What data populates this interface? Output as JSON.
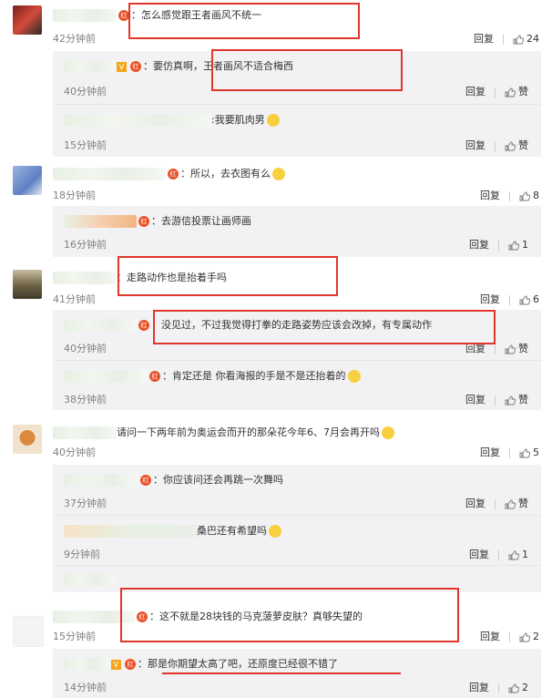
{
  "comments": [
    {
      "text": "：怎么感觉跟王者画风不统一",
      "time": "42分钟前",
      "reply": "回复",
      "likes": "24"
    },
    {
      "text": "：所以，去衣图有么",
      "time": "18分钟前",
      "reply": "回复",
      "likes": "8"
    },
    {
      "text": "：走路动作也是抬着手吗",
      "time": "41分钟前",
      "reply": "回复",
      "likes": "6"
    },
    {
      "text": "请问一下两年前为奥运会而开的那朵花今年6、7月会再开吗",
      "time": "40分钟前",
      "reply": "回复",
      "likes": "5"
    },
    {
      "text": "：这不就是28块钱的马克菠萝皮肤？真够失望的",
      "time": "15分钟前",
      "reply": "回复",
      "likes": "2"
    }
  ],
  "replies": [
    {
      "text": "：要仿真啊，王者画风不适合梅西",
      "time": "40分钟前",
      "reply": "回复",
      "likes": "赞"
    },
    {
      "text": ":我要肌肉男",
      "time": "15分钟前",
      "reply": "回复",
      "likes": "赞"
    },
    {
      "text": "：去游信投票让画师画",
      "time": "16分钟前",
      "reply": "回复",
      "likes": "1"
    },
    {
      "text": "：没见过，不过我觉得打拳的走路姿势应该会改掉，有专属动作",
      "time": "40分钟前",
      "reply": "回复",
      "likes": "赞"
    },
    {
      "text": "：肯定还是  你看海报的手是不是还抬着的",
      "time": "38分钟前",
      "reply": "回复",
      "likes": "赞"
    },
    {
      "text": "：你应该问还会再跳一次舞吗",
      "time": "37分钟前",
      "reply": "回复",
      "likes": "赞"
    },
    {
      "text": "桑巴还有希望吗",
      "time": "9分钟前",
      "reply": "回复",
      "likes": "1"
    },
    {
      "text": "：那是你期望太高了吧，还原度已经很不错了",
      "time": "14分钟前",
      "reply": "回复",
      "likes": "2"
    }
  ],
  "badges": {
    "red": "红",
    "v": "V"
  },
  "colors": {
    "highlight": "#e0362c",
    "reply_bg": "#f2f2f5",
    "time": "#808080"
  }
}
